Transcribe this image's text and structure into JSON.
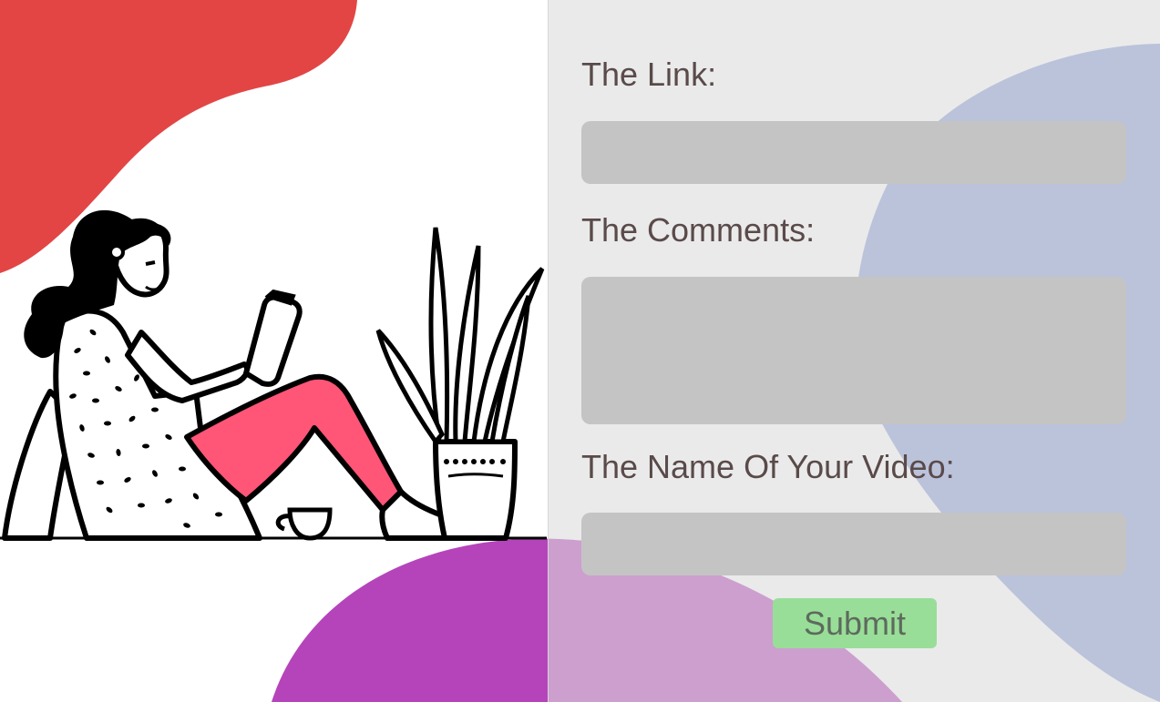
{
  "form": {
    "link_label": "The Link:",
    "link_value": "",
    "comments_label": "The Comments:",
    "comments_value": "",
    "video_name_label": "The Name Of Your Video:",
    "video_name_value": "",
    "submit_label": "Submit"
  },
  "colors": {
    "red_blob": "#e34545",
    "purple_blob": "#b544bb",
    "blue_blob": "#8b9ed9",
    "panel": "#dedede",
    "input": "#c4c4c4",
    "submit": "#98de98",
    "pants": "#ff5577"
  },
  "illustration": {
    "icon": "woman-reading-illustration"
  }
}
